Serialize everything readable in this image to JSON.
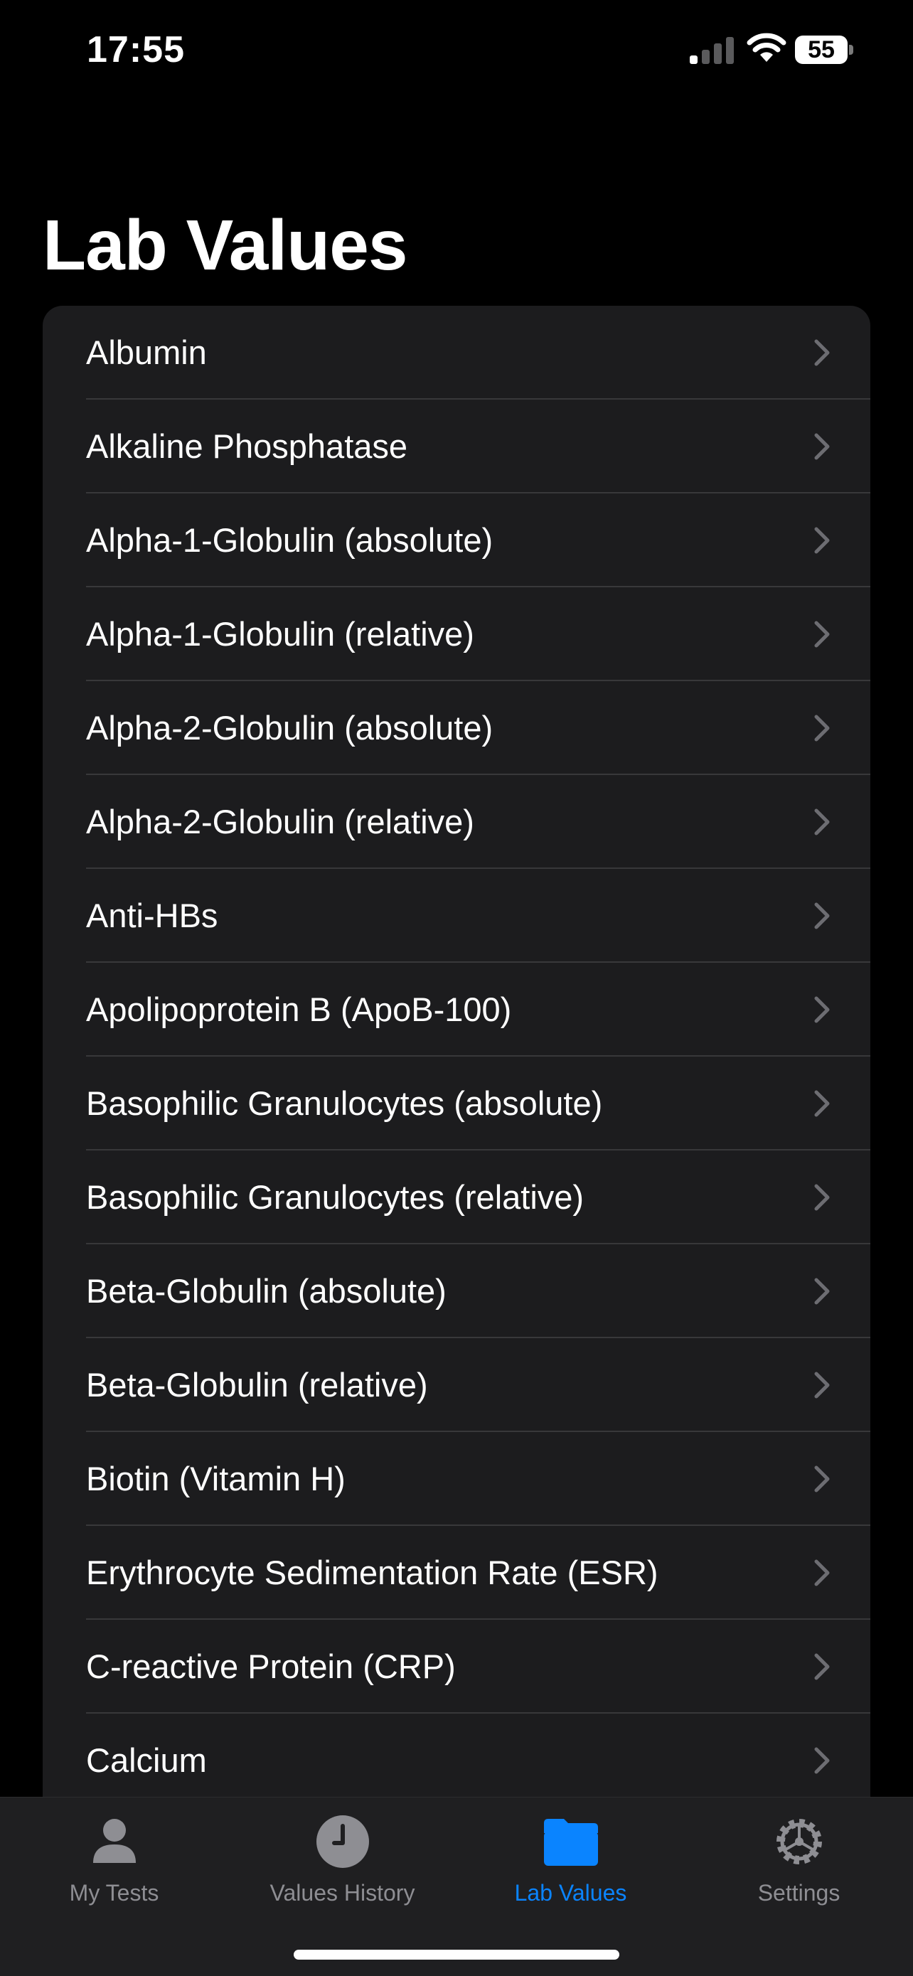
{
  "status": {
    "time": "17:55",
    "battery": "55"
  },
  "title": "Lab Values",
  "items": [
    {
      "label": "Albumin"
    },
    {
      "label": "Alkaline Phosphatase"
    },
    {
      "label": "Alpha-1-Globulin (absolute)"
    },
    {
      "label": "Alpha-1-Globulin (relative)"
    },
    {
      "label": "Alpha-2-Globulin (absolute)"
    },
    {
      "label": "Alpha-2-Globulin (relative)"
    },
    {
      "label": "Anti-HBs"
    },
    {
      "label": "Apolipoprotein B (ApoB-100)"
    },
    {
      "label": "Basophilic Granulocytes (absolute)"
    },
    {
      "label": "Basophilic Granulocytes (relative)"
    },
    {
      "label": "Beta-Globulin (absolute)"
    },
    {
      "label": "Beta-Globulin (relative)"
    },
    {
      "label": "Biotin (Vitamin H)"
    },
    {
      "label": "Erythrocyte Sedimentation Rate (ESR)"
    },
    {
      "label": "C-reactive Protein (CRP)"
    },
    {
      "label": "Calcium"
    }
  ],
  "tabs": [
    {
      "label": "My Tests",
      "icon": "person-icon"
    },
    {
      "label": "Values History",
      "icon": "clock-icon"
    },
    {
      "label": "Lab Values",
      "icon": "folder-icon",
      "active": true
    },
    {
      "label": "Settings",
      "icon": "gear-icon"
    }
  ],
  "colors": {
    "accent": "#0a84ff",
    "inactive": "#8e8e93",
    "card": "#1c1c1e",
    "background": "#000000"
  }
}
